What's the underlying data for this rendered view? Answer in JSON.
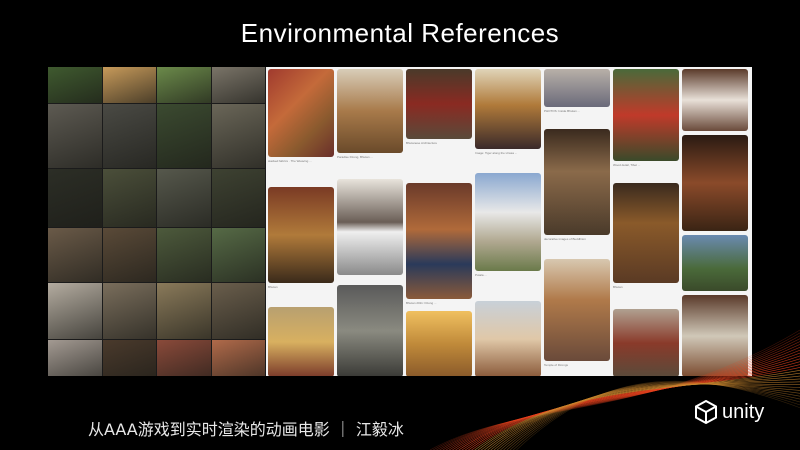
{
  "slide": {
    "title": "Environmental References",
    "footer": "从AAA游戏到实时渲染的动画电影 ｜ 江毅冰",
    "brand": "unity",
    "colors": {
      "background": "#000000",
      "board": "#f4f4f4",
      "swirl_accent": "#e8431f"
    }
  },
  "photo_tiles": [
    "#3f5a2f",
    "#c79a5a",
    "#6b8a4a",
    "#7a7468",
    "#5d5a52",
    "#4a4a44",
    "#3b4a30",
    "#6a6658",
    "#2c2e26",
    "#4b4f3a",
    "#56584c",
    "#3e4232",
    "#6a5a48",
    "#5a4a38",
    "#4d5a3c",
    "#566a46",
    "#b4aca0",
    "#7a6e5c",
    "#8a7a5a",
    "#6a5e4c",
    "#a39a92",
    "#4a3a2c",
    "#8a4a3a",
    "#b06a4a"
  ],
  "board_captions": [
    {
      "id": "c1",
      "text": "stacked fabrics · The Weaving ..."
    },
    {
      "id": "c2",
      "text": "Paradise Dzong, Bhutan ..."
    },
    {
      "id": "c3",
      "text": "Bhutanese Architecture"
    },
    {
      "id": "c4",
      "text": "Image: Tiger along the Lhasa ..."
    },
    {
      "id": "c5",
      "text": "PHOTOS: Inside Bhutan ..."
    },
    {
      "id": "c6",
      "text": "Wood detail, Tibet ..."
    },
    {
      "id": "c7",
      "text": "Bhutan"
    },
    {
      "id": "c8",
      "text": "Bhutan 2011: Dzong ..."
    },
    {
      "id": "c9",
      "text": "Potala ..."
    },
    {
      "id": "c10",
      "text": "decorative images of Buddhism"
    },
    {
      "id": "c11",
      "text": "Bhutan"
    },
    {
      "id": "c12",
      "text": "Temple of Dzongs"
    }
  ]
}
